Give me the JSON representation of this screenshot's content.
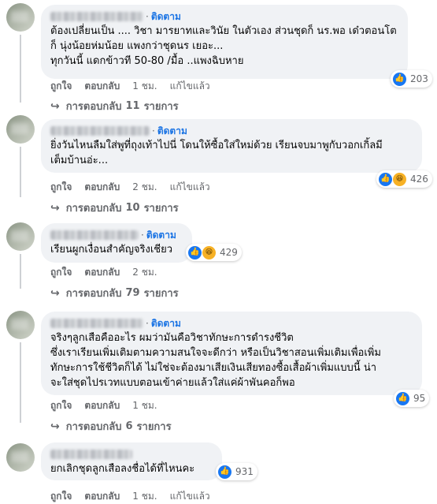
{
  "follow_label": "ติดตาม",
  "actions": {
    "like": "ถูกใจ",
    "reply": "ตอบกลับ",
    "edited": "แก้ไขแล้ว"
  },
  "replies_prefix": "การตอบกลับ",
  "replies_suffix": "รายการ",
  "comments": [
    {
      "text": "ต้องเปลี่ยนเป็น .... วิชา มารยาทและวินัย ในตัวเอง ส่วนชุดก็ นร.พอ เด๋วตอนโต\nก็ นุ่งน้อยห่มน้อย แพงกว่าชุดนร เยอะ...\nทุกวันนี้ แดกข้าวที 50-80 /มื้อ ..แพงฉิบหาย",
      "time": "1 ชม.",
      "reaction_count": "203",
      "reaction_icons": [
        "like-icon"
      ],
      "reply_count": "11"
    },
    {
      "text": "ยิ่งวันไหนลืมใส่พูที่ถุงเท้าไปนี่ โดนให้ซื้อใส่ใหม่ด้วย เรียนจบมาพูกับวอกเกิ้ลมี\nเต็มบ้านอ่ะ...",
      "time": "2 ชม.",
      "reaction_count": "426",
      "reaction_icons": [
        "like-icon",
        "haha-icon"
      ],
      "reply_count": "10"
    },
    {
      "text": "เรียนผูกเงื่อนสำคัญจริงเชียว",
      "time": "2 ชม.",
      "reaction_count": "429",
      "reaction_icons": [
        "like-icon",
        "haha-icon"
      ],
      "reply_count": "79"
    },
    {
      "text": "จริงๆลูกเสือคืออะไร ผมว่ามันคือวิชาทักษะการดำรงชีวิต\nซึ่งเราเรียนเพิ่มเติมตามความสนใจจะดีกว่า หรือเป็นวิชาสอนเพิ่มเติมเพื่อเพิ่ม\nทักษะการใช้ชีวิตก็ได้ ไม่ใช่จะต้องมาเสียเงินเสียทองซื้อเสื้อผ้าเพิ่มแบบนี้ น่า\nจะใส่ชุดไปรเวทแบบตอนเข้าค่ายแล้วใส่แค่ผ้าพันคอก็พอ",
      "time": "1 ชม.",
      "reaction_count": "95",
      "reaction_icons": [
        "like-icon"
      ],
      "reply_count": "6"
    },
    {
      "text": "ยกเลิกชุดลูกเสือลงชื่อได้ที่ไหนคะ",
      "time": "1 ชม.",
      "reaction_count": "931",
      "reaction_icons": [
        "like-icon"
      ],
      "reply_count": ""
    }
  ]
}
